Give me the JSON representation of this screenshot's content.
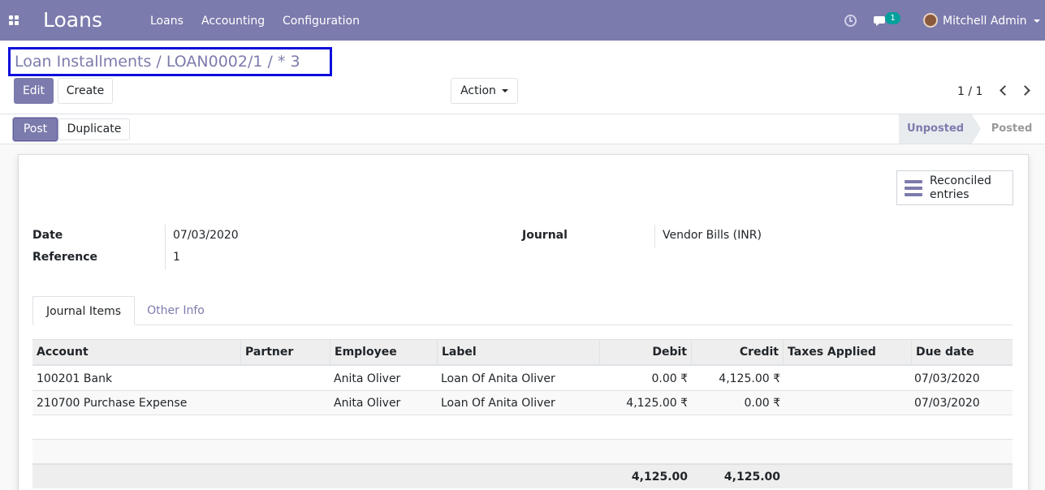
{
  "topbar": {
    "brand": "Loans",
    "menus": [
      "Loans",
      "Accounting",
      "Configuration"
    ],
    "message_count": "1",
    "user_name": "Mitchell Admin",
    "color": "#7c7bad"
  },
  "breadcrumb": "Loan Installments / LOAN0002/1 / * 3",
  "buttons": {
    "edit": "Edit",
    "create": "Create",
    "action": "Action",
    "post": "Post",
    "duplicate": "Duplicate"
  },
  "pager": "1 / 1",
  "statusbar": {
    "stages": [
      "Unposted",
      "Posted"
    ],
    "active": "Unposted"
  },
  "smart_button": {
    "label": "Reconciled entries",
    "icon": "list-icon"
  },
  "fields": {
    "date_label": "Date",
    "date": "07/03/2020",
    "reference_label": "Reference",
    "reference": "1",
    "journal_label": "Journal",
    "journal": "Vendor Bills (INR)"
  },
  "tabs": [
    "Journal Items",
    "Other Info"
  ],
  "table": {
    "headers": [
      "Account",
      "Partner",
      "Employee",
      "Label",
      "Debit",
      "Credit",
      "Taxes Applied",
      "Due date"
    ],
    "rows": [
      {
        "account": "100201 Bank",
        "partner": "",
        "employee": "Anita Oliver",
        "label": "Loan Of Anita Oliver",
        "debit": "0.00 ₹",
        "credit": "4,125.00 ₹",
        "taxes": "",
        "due": "07/03/2020"
      },
      {
        "account": "210700 Purchase Expense",
        "partner": "",
        "employee": "Anita Oliver",
        "label": "Loan Of Anita Oliver",
        "debit": "4,125.00 ₹",
        "credit": "0.00 ₹",
        "taxes": "",
        "due": "07/03/2020"
      }
    ],
    "total_debit": "4,125.00",
    "total_credit": "4,125.00"
  }
}
